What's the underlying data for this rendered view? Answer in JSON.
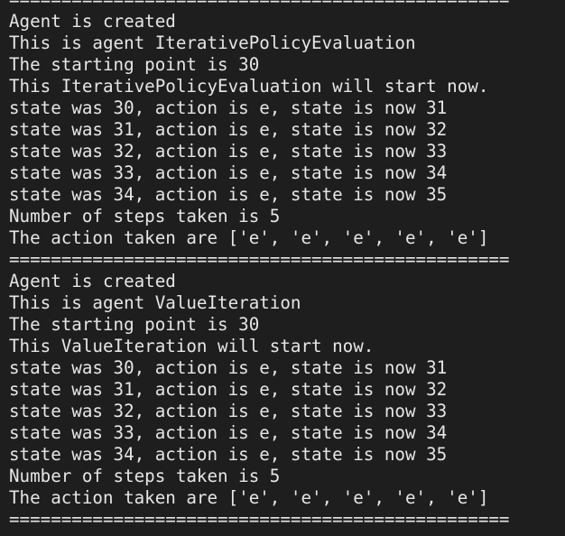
{
  "terminal": {
    "separator": "================================================",
    "blocks": [
      {
        "lines": [
          "Agent is created",
          "This is agent IterativePolicyEvaluation",
          "The starting point is 30",
          "This IterativePolicyEvaluation will start now.",
          "state was 30, action is e, state is now 31",
          "state was 31, action is e, state is now 32",
          "state was 32, action is e, state is now 33",
          "state was 33, action is e, state is now 34",
          "state was 34, action is e, state is now 35",
          "Number of steps taken is 5",
          "The action taken are ['e', 'e', 'e', 'e', 'e']"
        ]
      },
      {
        "lines": [
          "Agent is created",
          "This is agent ValueIteration",
          "The starting point is 30",
          "This ValueIteration will start now.",
          "state was 30, action is e, state is now 31",
          "state was 31, action is e, state is now 32",
          "state was 32, action is e, state is now 33",
          "state was 33, action is e, state is now 34",
          "state was 34, action is e, state is now 35",
          "Number of steps taken is 5",
          "The action taken are ['e', 'e', 'e', 'e', 'e']"
        ]
      }
    ]
  }
}
